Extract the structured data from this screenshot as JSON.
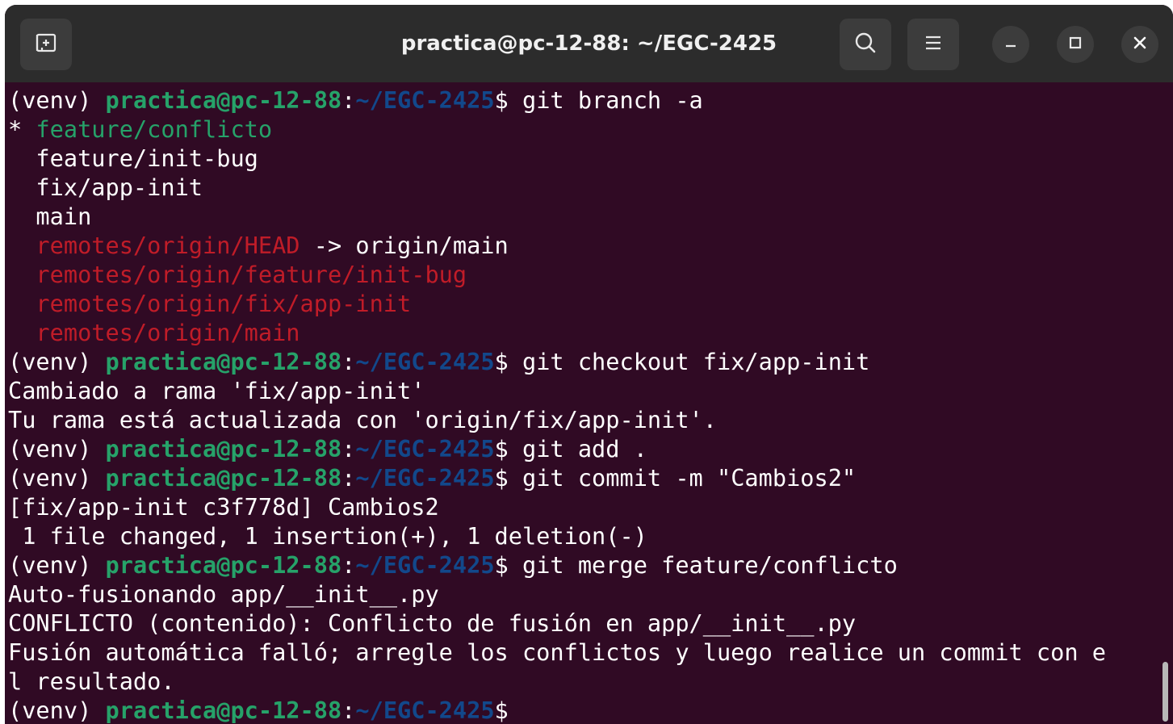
{
  "window": {
    "title": "practica@pc-12-88: ~/EGC-2425",
    "buttons": {
      "new_tab_icon": "tab-new-icon",
      "search_icon": "search-icon",
      "menu_icon": "hamburger-menu-icon",
      "minimize_icon": "minimize-icon",
      "maximize_icon": "maximize-icon",
      "close_icon": "close-icon"
    }
  },
  "colors": {
    "terminal_bg": "#300a24",
    "titlebar_bg": "#2c2c2c",
    "prompt_user": "#26a269",
    "prompt_path": "#12488b",
    "current_branch": "#26a269",
    "remote_branch": "#c01c28"
  },
  "prompt": {
    "venv": "(venv) ",
    "user": "practica@pc-12-88",
    "colon": ":",
    "path": "~/EGC-2425",
    "dollar": "$"
  },
  "terminal": {
    "lines": [
      {
        "type": "prompt",
        "command": " git branch -a"
      },
      {
        "type": "current_branch",
        "text": "* feature/conflicto"
      },
      {
        "type": "text",
        "text": "  feature/init-bug"
      },
      {
        "type": "text",
        "text": "  fix/app-init"
      },
      {
        "type": "text",
        "text": "  main"
      },
      {
        "type": "remote_head",
        "text": "  remotes/origin/HEAD",
        "rest": " -> origin/main"
      },
      {
        "type": "remote",
        "text": "  remotes/origin/feature/init-bug"
      },
      {
        "type": "remote",
        "text": "  remotes/origin/fix/app-init"
      },
      {
        "type": "remote",
        "text": "  remotes/origin/main"
      },
      {
        "type": "prompt",
        "command": " git checkout fix/app-init"
      },
      {
        "type": "text",
        "text": "Cambiado a rama 'fix/app-init'"
      },
      {
        "type": "text",
        "text": "Tu rama está actualizada con 'origin/fix/app-init'."
      },
      {
        "type": "prompt",
        "command": " git add ."
      },
      {
        "type": "prompt",
        "command": " git commit -m \"Cambios2\""
      },
      {
        "type": "text",
        "text": "[fix/app-init c3f778d] Cambios2"
      },
      {
        "type": "text",
        "text": " 1 file changed, 1 insertion(+), 1 deletion(-)"
      },
      {
        "type": "prompt",
        "command": " git merge feature/conflicto"
      },
      {
        "type": "text",
        "text": "Auto-fusionando app/__init__.py"
      },
      {
        "type": "text",
        "text": "CONFLICTO (contenido): Conflicto de fusión en app/__init__.py"
      },
      {
        "type": "text",
        "text": "Fusión automática falló; arregle los conflictos y luego realice un commit con e"
      },
      {
        "type": "text",
        "text": "l resultado."
      },
      {
        "type": "prompt",
        "command": ""
      }
    ]
  }
}
